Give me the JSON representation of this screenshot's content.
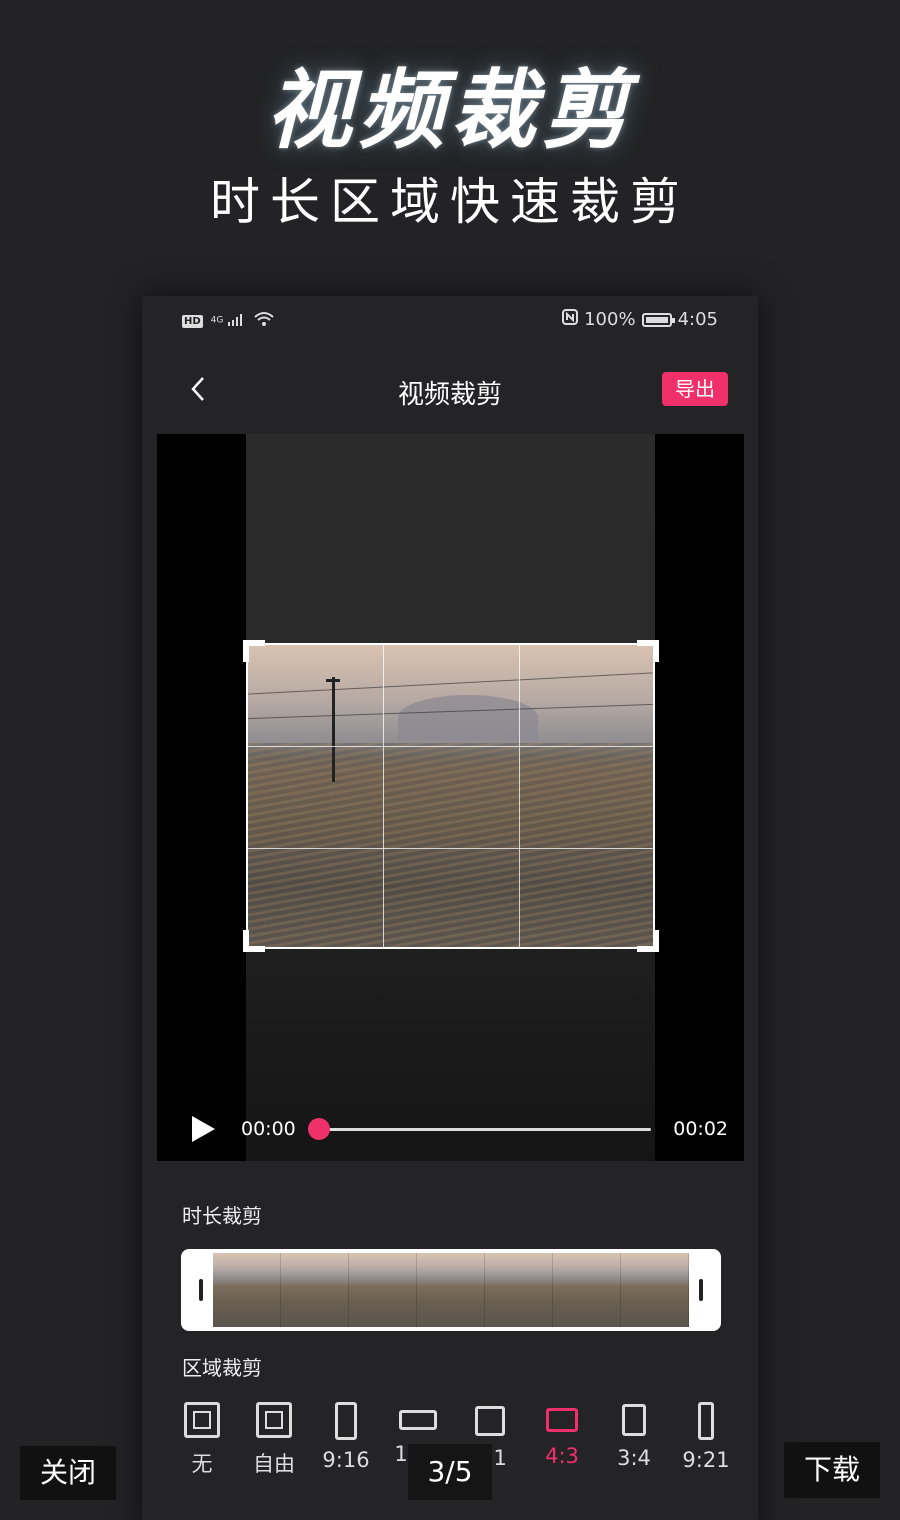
{
  "hero": {
    "title": "视频裁剪",
    "subtitle": "时长区域快速裁剪"
  },
  "status_bar": {
    "network": "4G",
    "battery": "100%",
    "time": "4:05"
  },
  "nav": {
    "title": "视频裁剪",
    "export_label": "导出"
  },
  "player": {
    "current_time": "00:00",
    "duration": "00:02",
    "progress": 0.0
  },
  "sections": {
    "duration_crop": "时长裁剪",
    "region_crop": "区域裁剪"
  },
  "ratios": [
    {
      "label": "无",
      "icon": "square-inset-icon"
    },
    {
      "label": "自由",
      "icon": "square-inset-icon"
    },
    {
      "label": "9:16",
      "icon": "portrait-rect-icon"
    },
    {
      "label": "16:9",
      "icon": "landscape-rect-icon"
    },
    {
      "label": "1:1",
      "icon": "square-icon"
    },
    {
      "label": "4:3",
      "icon": "landscape-rect-icon",
      "active": true
    },
    {
      "label": "3:4",
      "icon": "portrait-rect-icon"
    },
    {
      "label": "9:21",
      "icon": "tall-rect-icon"
    }
  ],
  "overlay": {
    "close_label": "关闭",
    "page_indicator": "3/5",
    "download_label": "下载"
  },
  "colors": {
    "accent": "#f0306a",
    "background": "#232325"
  }
}
